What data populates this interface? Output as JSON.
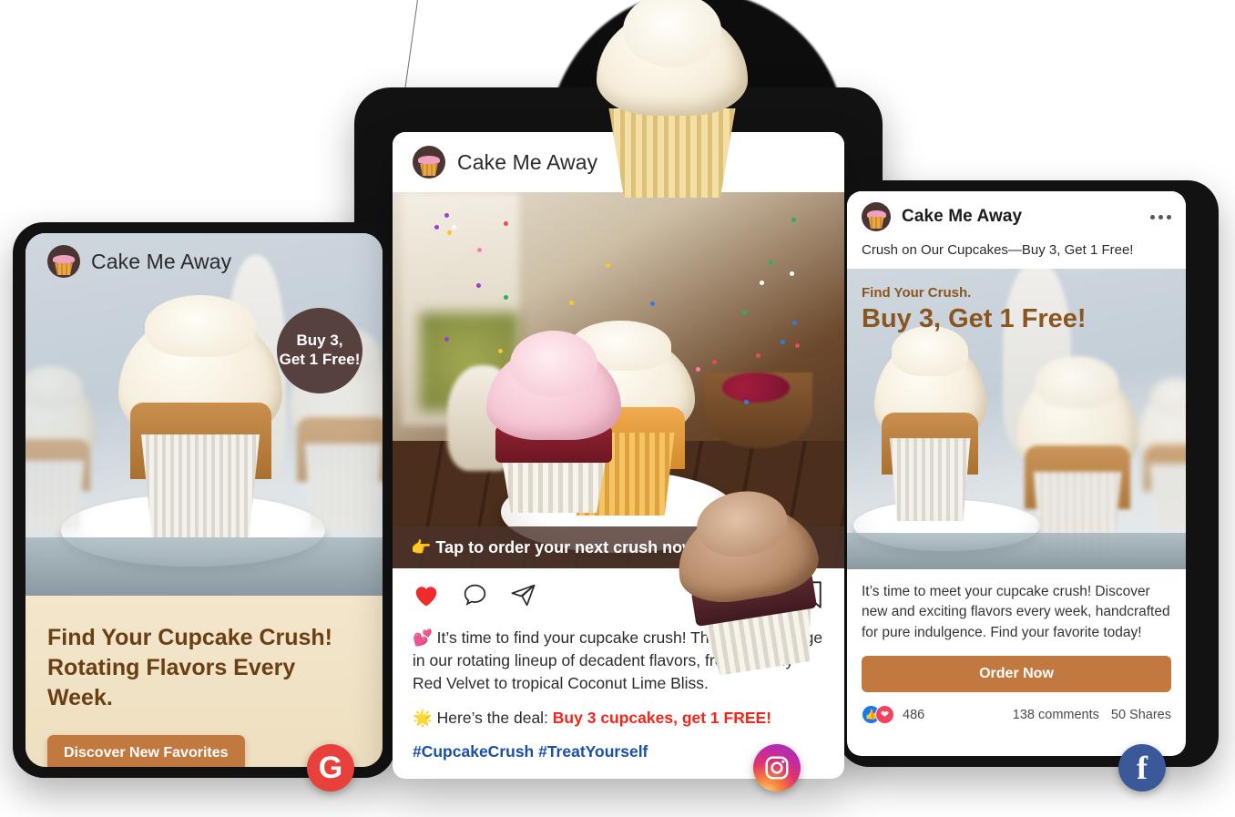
{
  "brand": {
    "name": "Cake Me Away",
    "avatar_icon": "cupcake-logo-icon"
  },
  "colors": {
    "badge_brown": "#57413F",
    "cta_orange": "#C2793F",
    "heading_brown": "#6B3F14",
    "fb_heading_brown": "#8A5620",
    "deal_red": "#F0251B",
    "hashtag_blue": "#1A4FA8",
    "google_red": "#E8403A",
    "facebook_blue": "#3B5998"
  },
  "google_ad": {
    "brand_name": "Cake Me Away",
    "offer_badge_line1": "Buy 3,",
    "offer_badge_line2": "Get 1 Free!",
    "headline_line1": "Find Your Cupcake Crush!",
    "headline_line2": "Rotating Flavors Every Week.",
    "cta_label": "Discover New Favorites",
    "platform_badge": "google-badge-icon",
    "platform_letter": "G"
  },
  "instagram_post": {
    "brand_name": "Cake Me Away",
    "image_overlay_cta": "👉 Tap to order your next crush now!",
    "actions": [
      "like-icon",
      "comment-icon",
      "share-icon",
      "bookmark-icon"
    ],
    "caption_emoji": "💕",
    "caption_body": "It’s time to find your cupcake crush! This week, indulge in our rotating lineup of decadent flavors, from creamy Red Velvet to tropical Coconut Lime Bliss.",
    "deal_emoji": "🌟",
    "deal_prefix": "Here’s the deal: ",
    "deal_highlight": "Buy 3 cupcakes, get 1 FREE!",
    "hashtags": "#CupcakeCrush #TreatYourself",
    "platform_badge": "instagram-badge-icon"
  },
  "facebook_post": {
    "brand_name": "Cake Me Away",
    "menu_icon": "more-options-icon",
    "subtitle": "Crush on Our Cupcakes—Buy 3, Get 1 Free!",
    "overlay_kicker": "Find Your Crush.",
    "overlay_headline": "Buy 3, Get 1 Free!",
    "body": "It’s time to meet your cupcake crush! Discover new and exciting flavors every week, handcrafted for pure indulgence. Find your favorite today!",
    "cta_label": "Order Now",
    "reactions_count": "486",
    "comments_label": "138 comments",
    "shares_label": "50 Shares",
    "platform_badge": "facebook-badge-icon",
    "platform_letter": "f"
  }
}
